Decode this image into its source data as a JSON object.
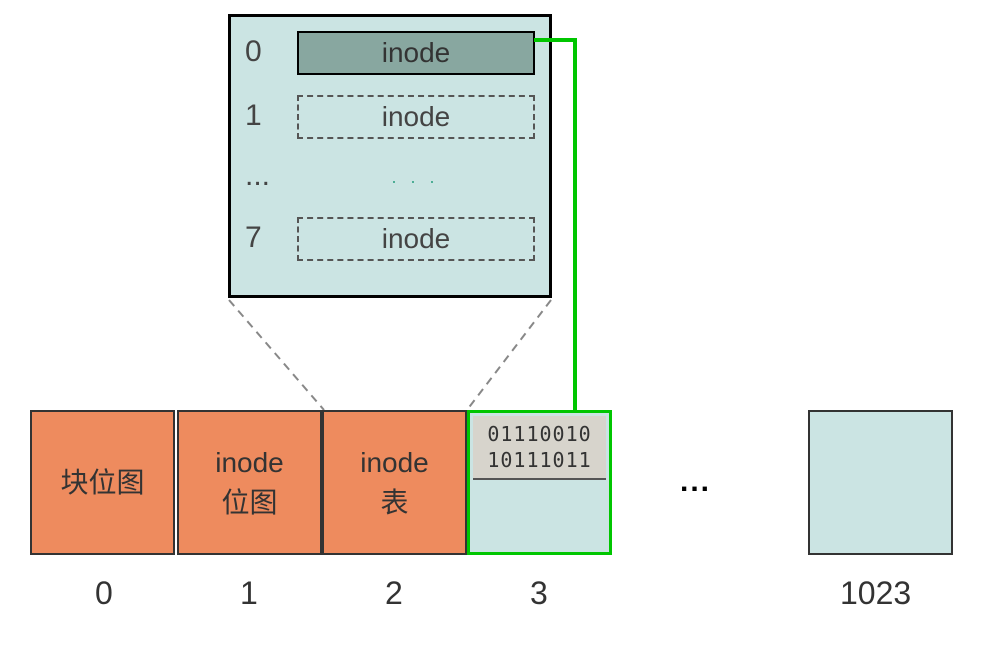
{
  "zoom": {
    "rows": [
      {
        "idx": "0",
        "label": "inode",
        "solid": true
      },
      {
        "idx": "1",
        "label": "inode",
        "solid": false
      },
      {
        "idx": "...",
        "label": "",
        "solid": false,
        "ellipsis": true
      },
      {
        "idx": "7",
        "label": "inode",
        "solid": false
      }
    ]
  },
  "blocks": {
    "b0": "块位图",
    "b1_l1": "inode",
    "b1_l2": "位图",
    "b2_l1": "inode",
    "b2_l2": "表",
    "bits_l1": "01110010",
    "bits_l2": "10111011"
  },
  "dots": "...",
  "indices": {
    "i0": "0",
    "i1": "1",
    "i2": "2",
    "i3": "3",
    "i1023": "1023"
  }
}
